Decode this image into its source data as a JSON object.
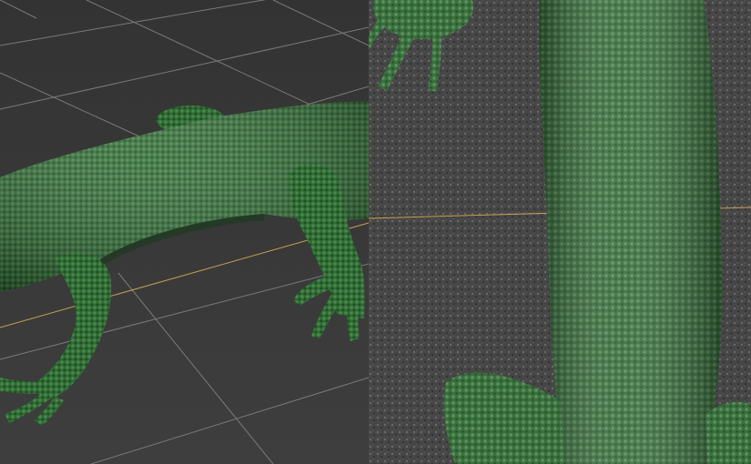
{
  "colors": {
    "viewport_background": "#3a3a3a",
    "grid_line": "#8a8a8a",
    "grid_axis": "#c8a050",
    "model_base": "#2f6a34",
    "model_shadow": "#1d4420",
    "model_highlight": "#5a9a5a",
    "ground_texture": "#4a4a4a"
  },
  "icons": {
    "left_panel": "viewport-perspective",
    "right_panel": "viewport-closeup"
  }
}
